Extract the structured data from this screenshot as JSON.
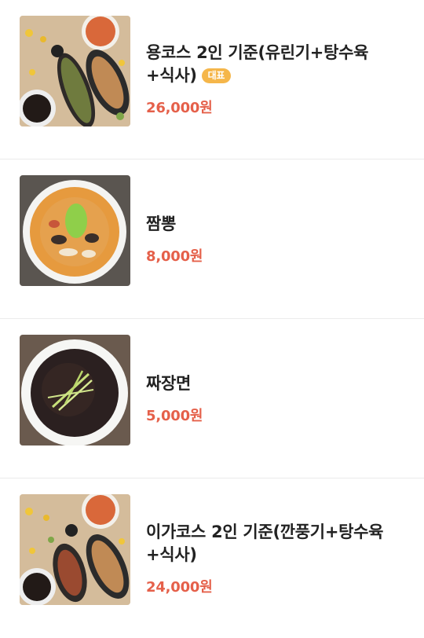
{
  "menu": {
    "items": [
      {
        "name": "용코스 2인 기준(유린기+탕수육+식사)",
        "badge": "대표",
        "price": "26,000원",
        "image": "course-dishes-photo"
      },
      {
        "name": "짬뽕",
        "price": "8,000원",
        "image": "jjamppong-photo"
      },
      {
        "name": "짜장면",
        "price": "5,000원",
        "image": "jajangmyeon-photo"
      },
      {
        "name": "이가코스 2인 기준(깐풍기+탕수육+식사)",
        "price": "24,000원",
        "image": "course-dishes-photo"
      }
    ]
  }
}
